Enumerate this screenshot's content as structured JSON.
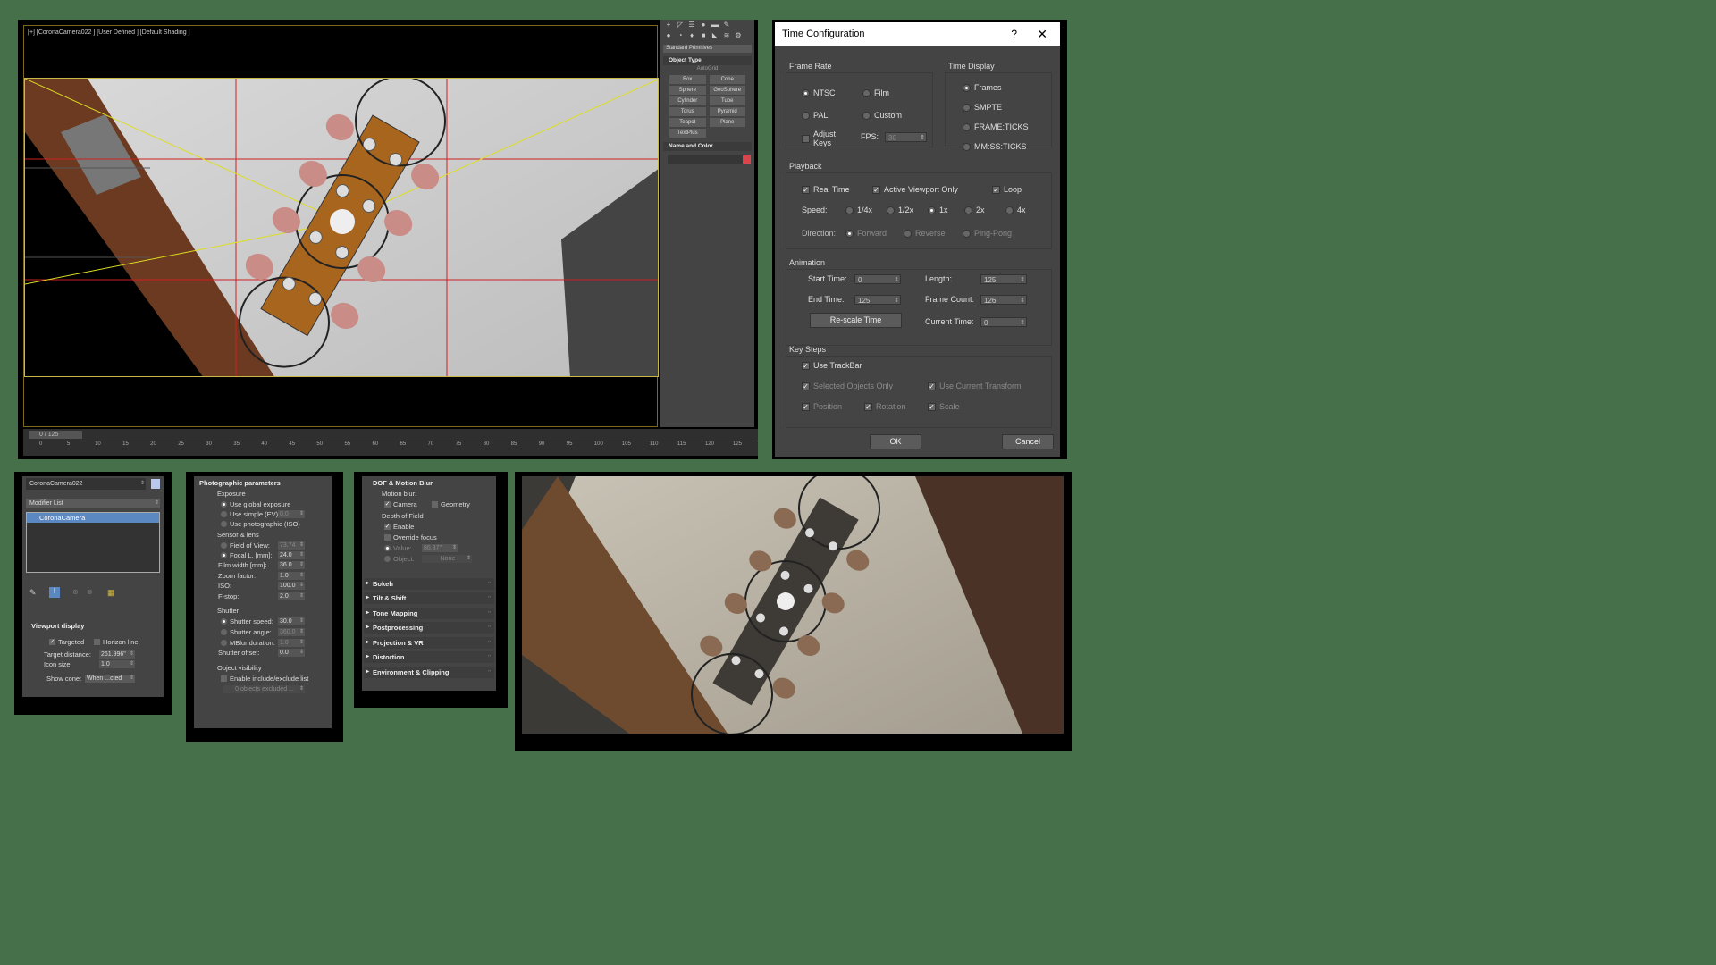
{
  "viewport": {
    "label": "[+] [CoronaCamera022 ] [User Defined ] [Default Shading ]",
    "time_slider": "0 / 125",
    "ticks": [
      "0",
      "5",
      "10",
      "15",
      "20",
      "25",
      "30",
      "35",
      "40",
      "45",
      "50",
      "55",
      "60",
      "65",
      "70",
      "75",
      "80",
      "85",
      "90",
      "95",
      "100",
      "105",
      "110",
      "115",
      "120",
      "125"
    ]
  },
  "command_panel": {
    "dropdown": "Standard Primitives",
    "object_type_title": "Object Type",
    "autogrid": "AutoGrid",
    "buttons": [
      "Box",
      "Cone",
      "Sphere",
      "GeoSphere",
      "Cylinder",
      "Tube",
      "Torus",
      "Pyramid",
      "Teapot",
      "Plane",
      "TextPlus"
    ],
    "name_color_title": "Name and Color"
  },
  "dialog": {
    "title": "Time Configuration",
    "help": "?",
    "close": "✕",
    "frame_rate": {
      "title": "Frame Rate",
      "ntsc": "NTSC",
      "film": "Film",
      "pal": "PAL",
      "custom": "Custom",
      "adjust_keys": "Adjust Keys",
      "fps_label": "FPS:",
      "fps_value": "30"
    },
    "time_display": {
      "title": "Time Display",
      "frames": "Frames",
      "smpte": "SMPTE",
      "frame_ticks": "FRAME:TICKS",
      "mmss": "MM:SS:TICKS"
    },
    "playback": {
      "title": "Playback",
      "real_time": "Real Time",
      "active_viewport": "Active Viewport Only",
      "loop": "Loop",
      "speed_label": "Speed:",
      "speeds": [
        "1/4x",
        "1/2x",
        "1x",
        "2x",
        "4x"
      ],
      "direction_label": "Direction:",
      "forward": "Forward",
      "reverse": "Reverse",
      "ping_pong": "Ping-Pong"
    },
    "animation": {
      "title": "Animation",
      "start_label": "Start Time:",
      "start_value": "0",
      "length_label": "Length:",
      "length_value": "125",
      "end_label": "End Time:",
      "end_value": "125",
      "frame_count_label": "Frame Count:",
      "frame_count_value": "126",
      "rescale": "Re-scale Time",
      "current_label": "Current Time:",
      "current_value": "0"
    },
    "key_steps": {
      "title": "Key Steps",
      "use_trackbar": "Use TrackBar",
      "selected_only": "Selected Objects Only",
      "use_current": "Use Current Transform",
      "position": "Position",
      "rotation": "Rotation",
      "scale": "Scale"
    },
    "ok": "OK",
    "cancel": "Cancel"
  },
  "modifier_panel": {
    "name": "CoronaCamera022",
    "modifier_list": "Modifier List",
    "stack_item": "CoronaCamera",
    "viewport_display": "Viewport display",
    "targeted": "Targeted",
    "horizon": "Horizon line",
    "target_distance_label": "Target distance:",
    "target_distance": "261.996\"",
    "icon_size_label": "Icon size:",
    "icon_size": "1.0",
    "show_cone_label": "Show cone:",
    "show_cone": "When ...cted"
  },
  "photo_panel": {
    "title": "Photographic parameters",
    "exposure": "Exposure",
    "use_global": "Use global exposure",
    "use_simple": "Use simple (EV)",
    "simple_val": "0.0",
    "use_photo": "Use photographic (ISO)",
    "sensor": "Sensor & lens",
    "fov_label": "Field of View:",
    "fov": "73.74",
    "focal_label": "Focal L. [mm]:",
    "focal": "24.0",
    "film_label": "Film width [mm]:",
    "film": "36.0",
    "zoom_label": "Zoom factor:",
    "zoom": "1.0",
    "iso_label": "ISO:",
    "iso": "100.0",
    "fstop_label": "F-stop:",
    "fstop": "2.0",
    "shutter": "Shutter",
    "shutter_speed_label": "Shutter speed:",
    "shutter_speed": "30.0",
    "shutter_angle_label": "Shutter angle:",
    "shutter_angle": "360.0",
    "mblur_label": "MBlur duration:",
    "mblur": "1.0",
    "offset_label": "Shutter offset:",
    "offset": "0.0",
    "visibility": "Object visibility",
    "include": "Enable include/exclude list",
    "excluded": "0 objects excluded ..."
  },
  "dof_panel": {
    "title": "DOF & Motion Blur",
    "motion_blur": "Motion blur:",
    "camera": "Camera",
    "geometry": "Geometry",
    "dof": "Depth of Field",
    "enable": "Enable",
    "override": "Override focus",
    "value_label": "Value:",
    "value": "86.37\"",
    "object_label": "Object:",
    "object": "None",
    "rollouts": [
      "Bokeh",
      "Tilt & Shift",
      "Tone Mapping",
      "Postprocessing",
      "Projection & VR",
      "Distortion",
      "Environment & Clipping"
    ]
  }
}
